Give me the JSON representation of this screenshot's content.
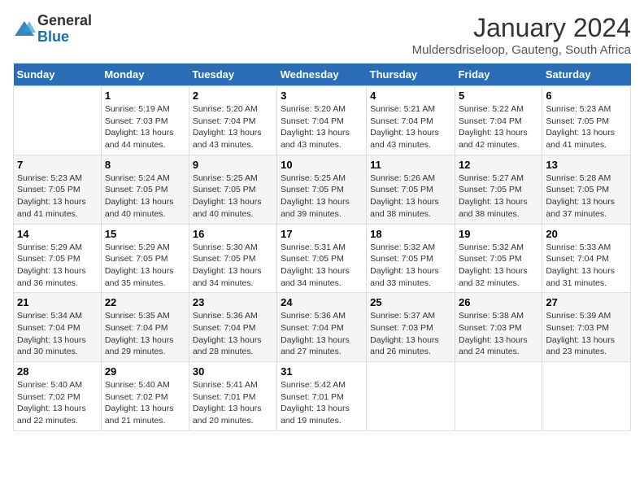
{
  "header": {
    "logo_general": "General",
    "logo_blue": "Blue",
    "month_year": "January 2024",
    "location": "Muldersdriseloop, Gauteng, South Africa"
  },
  "days_of_week": [
    "Sunday",
    "Monday",
    "Tuesday",
    "Wednesday",
    "Thursday",
    "Friday",
    "Saturday"
  ],
  "weeks": [
    [
      {
        "day": "",
        "sunrise": "",
        "sunset": "",
        "daylight": "",
        "empty": true
      },
      {
        "day": "1",
        "sunrise": "Sunrise: 5:19 AM",
        "sunset": "Sunset: 7:03 PM",
        "daylight": "Daylight: 13 hours and 44 minutes."
      },
      {
        "day": "2",
        "sunrise": "Sunrise: 5:20 AM",
        "sunset": "Sunset: 7:04 PM",
        "daylight": "Daylight: 13 hours and 43 minutes."
      },
      {
        "day": "3",
        "sunrise": "Sunrise: 5:20 AM",
        "sunset": "Sunset: 7:04 PM",
        "daylight": "Daylight: 13 hours and 43 minutes."
      },
      {
        "day": "4",
        "sunrise": "Sunrise: 5:21 AM",
        "sunset": "Sunset: 7:04 PM",
        "daylight": "Daylight: 13 hours and 43 minutes."
      },
      {
        "day": "5",
        "sunrise": "Sunrise: 5:22 AM",
        "sunset": "Sunset: 7:04 PM",
        "daylight": "Daylight: 13 hours and 42 minutes."
      },
      {
        "day": "6",
        "sunrise": "Sunrise: 5:23 AM",
        "sunset": "Sunset: 7:05 PM",
        "daylight": "Daylight: 13 hours and 41 minutes."
      }
    ],
    [
      {
        "day": "7",
        "sunrise": "Sunrise: 5:23 AM",
        "sunset": "Sunset: 7:05 PM",
        "daylight": "Daylight: 13 hours and 41 minutes."
      },
      {
        "day": "8",
        "sunrise": "Sunrise: 5:24 AM",
        "sunset": "Sunset: 7:05 PM",
        "daylight": "Daylight: 13 hours and 40 minutes."
      },
      {
        "day": "9",
        "sunrise": "Sunrise: 5:25 AM",
        "sunset": "Sunset: 7:05 PM",
        "daylight": "Daylight: 13 hours and 40 minutes."
      },
      {
        "day": "10",
        "sunrise": "Sunrise: 5:25 AM",
        "sunset": "Sunset: 7:05 PM",
        "daylight": "Daylight: 13 hours and 39 minutes."
      },
      {
        "day": "11",
        "sunrise": "Sunrise: 5:26 AM",
        "sunset": "Sunset: 7:05 PM",
        "daylight": "Daylight: 13 hours and 38 minutes."
      },
      {
        "day": "12",
        "sunrise": "Sunrise: 5:27 AM",
        "sunset": "Sunset: 7:05 PM",
        "daylight": "Daylight: 13 hours and 38 minutes."
      },
      {
        "day": "13",
        "sunrise": "Sunrise: 5:28 AM",
        "sunset": "Sunset: 7:05 PM",
        "daylight": "Daylight: 13 hours and 37 minutes."
      }
    ],
    [
      {
        "day": "14",
        "sunrise": "Sunrise: 5:29 AM",
        "sunset": "Sunset: 7:05 PM",
        "daylight": "Daylight: 13 hours and 36 minutes."
      },
      {
        "day": "15",
        "sunrise": "Sunrise: 5:29 AM",
        "sunset": "Sunset: 7:05 PM",
        "daylight": "Daylight: 13 hours and 35 minutes."
      },
      {
        "day": "16",
        "sunrise": "Sunrise: 5:30 AM",
        "sunset": "Sunset: 7:05 PM",
        "daylight": "Daylight: 13 hours and 34 minutes."
      },
      {
        "day": "17",
        "sunrise": "Sunrise: 5:31 AM",
        "sunset": "Sunset: 7:05 PM",
        "daylight": "Daylight: 13 hours and 34 minutes."
      },
      {
        "day": "18",
        "sunrise": "Sunrise: 5:32 AM",
        "sunset": "Sunset: 7:05 PM",
        "daylight": "Daylight: 13 hours and 33 minutes."
      },
      {
        "day": "19",
        "sunrise": "Sunrise: 5:32 AM",
        "sunset": "Sunset: 7:05 PM",
        "daylight": "Daylight: 13 hours and 32 minutes."
      },
      {
        "day": "20",
        "sunrise": "Sunrise: 5:33 AM",
        "sunset": "Sunset: 7:04 PM",
        "daylight": "Daylight: 13 hours and 31 minutes."
      }
    ],
    [
      {
        "day": "21",
        "sunrise": "Sunrise: 5:34 AM",
        "sunset": "Sunset: 7:04 PM",
        "daylight": "Daylight: 13 hours and 30 minutes."
      },
      {
        "day": "22",
        "sunrise": "Sunrise: 5:35 AM",
        "sunset": "Sunset: 7:04 PM",
        "daylight": "Daylight: 13 hours and 29 minutes."
      },
      {
        "day": "23",
        "sunrise": "Sunrise: 5:36 AM",
        "sunset": "Sunset: 7:04 PM",
        "daylight": "Daylight: 13 hours and 28 minutes."
      },
      {
        "day": "24",
        "sunrise": "Sunrise: 5:36 AM",
        "sunset": "Sunset: 7:04 PM",
        "daylight": "Daylight: 13 hours and 27 minutes."
      },
      {
        "day": "25",
        "sunrise": "Sunrise: 5:37 AM",
        "sunset": "Sunset: 7:03 PM",
        "daylight": "Daylight: 13 hours and 26 minutes."
      },
      {
        "day": "26",
        "sunrise": "Sunrise: 5:38 AM",
        "sunset": "Sunset: 7:03 PM",
        "daylight": "Daylight: 13 hours and 24 minutes."
      },
      {
        "day": "27",
        "sunrise": "Sunrise: 5:39 AM",
        "sunset": "Sunset: 7:03 PM",
        "daylight": "Daylight: 13 hours and 23 minutes."
      }
    ],
    [
      {
        "day": "28",
        "sunrise": "Sunrise: 5:40 AM",
        "sunset": "Sunset: 7:02 PM",
        "daylight": "Daylight: 13 hours and 22 minutes."
      },
      {
        "day": "29",
        "sunrise": "Sunrise: 5:40 AM",
        "sunset": "Sunset: 7:02 PM",
        "daylight": "Daylight: 13 hours and 21 minutes."
      },
      {
        "day": "30",
        "sunrise": "Sunrise: 5:41 AM",
        "sunset": "Sunset: 7:01 PM",
        "daylight": "Daylight: 13 hours and 20 minutes."
      },
      {
        "day": "31",
        "sunrise": "Sunrise: 5:42 AM",
        "sunset": "Sunset: 7:01 PM",
        "daylight": "Daylight: 13 hours and 19 minutes."
      },
      {
        "day": "",
        "sunrise": "",
        "sunset": "",
        "daylight": "",
        "empty": true
      },
      {
        "day": "",
        "sunrise": "",
        "sunset": "",
        "daylight": "",
        "empty": true
      },
      {
        "day": "",
        "sunrise": "",
        "sunset": "",
        "daylight": "",
        "empty": true
      }
    ]
  ]
}
